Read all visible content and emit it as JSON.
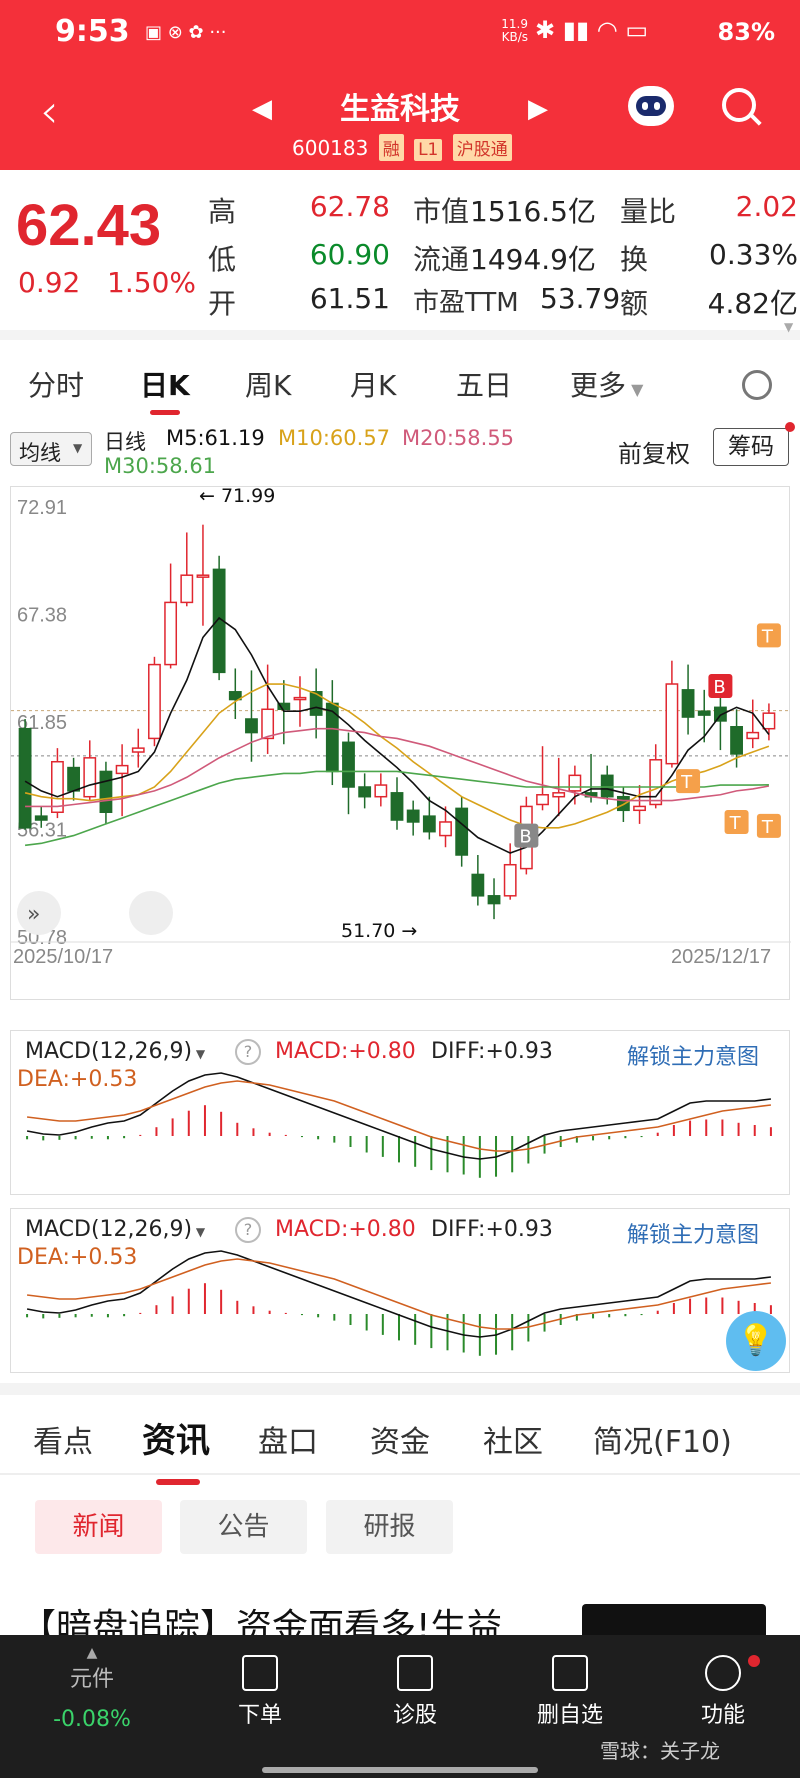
{
  "status": {
    "time": "9:53",
    "net": "11.9 KB/s",
    "battery": "83%"
  },
  "nav": {
    "title": "生益科技",
    "code": "600183",
    "tags": [
      "融",
      "L1",
      "沪股通"
    ]
  },
  "quote": {
    "price": "62.43",
    "change": "0.92",
    "change_pct": "1.50%",
    "rows": [
      {
        "l1": "高",
        "v1": "62.78",
        "l2": "市值",
        "v2": "1516.5亿",
        "l3": "量比",
        "v3": "2.02"
      },
      {
        "l1": "低",
        "v1": "60.90",
        "l2": "流通",
        "v2": "1494.9亿",
        "l3": "换",
        "v3": "0.33%"
      },
      {
        "l1": "开",
        "v1": "61.51",
        "l2": "市盈TTM",
        "v2": "53.79",
        "l3": "额",
        "v3": "4.82亿"
      }
    ]
  },
  "ktabs": [
    "分时",
    "日K",
    "周K",
    "月K",
    "五日",
    "更多"
  ],
  "ma": {
    "selector": "均线",
    "period": "日线",
    "m5": "M5:61.19",
    "m10": "M10:60.57",
    "m20": "M20:58.55",
    "m30": "M30:58.61",
    "adjust": "前复权",
    "chip_btn": "筹码"
  },
  "chart_data": {
    "type": "candlestick",
    "x_start": "2025/10/17",
    "x_end": "2025/12/17",
    "y_ticks": [
      "72.91",
      "67.38",
      "61.85",
      "56.31",
      "50.78"
    ],
    "ylim": [
      50.78,
      72.91
    ],
    "high_marker": "71.99",
    "low_marker": "51.70",
    "candles": [
      [
        61.5,
        56.4,
        62.0,
        56.3
      ],
      [
        57.0,
        56.8,
        57.5,
        56.4
      ],
      [
        57.2,
        59.8,
        60.5,
        56.9
      ],
      [
        59.5,
        58.3,
        60.0,
        57.8
      ],
      [
        58.0,
        60.0,
        60.9,
        57.8
      ],
      [
        59.3,
        57.2,
        59.8,
        56.6
      ],
      [
        59.2,
        59.6,
        60.7,
        57.0
      ],
      [
        60.3,
        60.5,
        61.5,
        59.5
      ],
      [
        61.0,
        64.8,
        65.2,
        60.6
      ],
      [
        64.8,
        68.0,
        70.0,
        64.6
      ],
      [
        68.0,
        69.4,
        71.6,
        67.8
      ],
      [
        69.3,
        69.4,
        72.0,
        66.8
      ],
      [
        69.7,
        64.4,
        70.4,
        64.0
      ],
      [
        63.4,
        63.0,
        64.6,
        62.0
      ],
      [
        62.0,
        61.3,
        64.5,
        59.8
      ],
      [
        61.0,
        62.5,
        64.8,
        60.2
      ],
      [
        62.8,
        62.5,
        64.0,
        60.7
      ],
      [
        63.0,
        63.1,
        64.2,
        61.6
      ],
      [
        63.4,
        62.2,
        64.6,
        61.0
      ],
      [
        62.8,
        59.3,
        64.0,
        58.6
      ],
      [
        60.8,
        58.5,
        61.3,
        57.1
      ],
      [
        58.5,
        58.0,
        59.2,
        57.4
      ],
      [
        58.0,
        58.6,
        59.2,
        57.5
      ],
      [
        58.2,
        56.8,
        59.0,
        56.3
      ],
      [
        57.3,
        56.7,
        57.8,
        56.0
      ],
      [
        57.0,
        56.2,
        58.0,
        55.8
      ],
      [
        56.0,
        56.7,
        57.5,
        55.4
      ],
      [
        57.4,
        55.0,
        58.0,
        54.4
      ],
      [
        54.0,
        52.9,
        55.0,
        52.4
      ],
      [
        52.9,
        52.5,
        53.8,
        51.7
      ],
      [
        52.9,
        54.5,
        55.6,
        52.7
      ],
      [
        54.3,
        57.5,
        58.0,
        54.0
      ],
      [
        57.6,
        58.1,
        60.6,
        57.3
      ],
      [
        58.0,
        58.2,
        60.0,
        57.0
      ],
      [
        58.3,
        59.1,
        59.6,
        57.6
      ],
      [
        58.2,
        58.0,
        60.2,
        57.7
      ],
      [
        59.1,
        58.0,
        59.6,
        57.6
      ],
      [
        58.0,
        57.3,
        58.5,
        56.7
      ],
      [
        57.3,
        57.5,
        58.6,
        56.6
      ],
      [
        57.6,
        59.9,
        60.7,
        57.4
      ],
      [
        59.7,
        63.8,
        65.0,
        59.5
      ],
      [
        63.5,
        62.1,
        64.8,
        61.2
      ],
      [
        62.4,
        62.2,
        63.5,
        60.8
      ],
      [
        62.6,
        61.9,
        63.3,
        60.4
      ],
      [
        61.6,
        60.2,
        62.5,
        59.5
      ],
      [
        61.0,
        61.3,
        63.0,
        60.5
      ],
      [
        61.5,
        62.3,
        62.8,
        60.9
      ]
    ],
    "ma_lines": [
      {
        "name": "M5",
        "color": "#111111",
        "values": [
          58.8,
          58.3,
          58.0,
          58.3,
          58.6,
          58.8,
          59.0,
          59.3,
          60.3,
          62.3,
          64.0,
          66.2,
          67.2,
          66.6,
          65.3,
          63.7,
          62.4,
          62.4,
          62.6,
          62.4,
          61.7,
          60.9,
          60.2,
          59.5,
          58.7,
          57.8,
          57.3,
          56.6,
          55.9,
          55.5,
          55.1,
          55.4,
          56.2,
          57.1,
          58.0,
          58.4,
          58.4,
          58.2,
          58.0,
          58.0,
          59.1,
          60.4,
          61.1,
          62.2,
          62.6,
          62.3,
          61.2
        ]
      },
      {
        "name": "M10",
        "color": "#d8a21a",
        "values": [
          58.2,
          58.0,
          57.9,
          57.9,
          57.8,
          57.9,
          58.0,
          58.1,
          58.5,
          59.3,
          60.3,
          61.3,
          62.3,
          62.9,
          63.4,
          63.8,
          63.8,
          63.6,
          63.3,
          62.8,
          62.4,
          61.8,
          61.1,
          60.5,
          59.8,
          59.2,
          58.6,
          58.0,
          57.6,
          57.2,
          56.8,
          56.5,
          56.4,
          56.4,
          56.6,
          56.9,
          57.2,
          57.6,
          58.1,
          58.4,
          58.8,
          59.1,
          59.3,
          59.6,
          60.0,
          60.3,
          60.6
        ]
      },
      {
        "name": "M20",
        "color": "#d05a7a",
        "values": [
          57.5,
          57.5,
          57.5,
          57.6,
          57.7,
          57.8,
          57.9,
          58.1,
          58.3,
          58.6,
          59.0,
          59.5,
          60.0,
          60.4,
          60.8,
          61.1,
          61.3,
          61.4,
          61.5,
          61.5,
          61.4,
          61.3,
          61.1,
          61.0,
          60.8,
          60.6,
          60.3,
          60.0,
          59.7,
          59.4,
          59.1,
          58.8,
          58.6,
          58.4,
          58.2,
          58.0,
          57.9,
          57.8,
          57.8,
          57.8,
          57.8,
          57.9,
          58.0,
          58.1,
          58.3,
          58.4,
          58.55
        ]
      },
      {
        "name": "M30",
        "color": "#4ca64c",
        "values": [
          55.5,
          55.6,
          55.8,
          56.0,
          56.3,
          56.6,
          56.9,
          57.2,
          57.5,
          57.8,
          58.1,
          58.4,
          58.7,
          58.9,
          59.0,
          59.1,
          59.2,
          59.2,
          59.3,
          59.3,
          59.3,
          59.3,
          59.3,
          59.3,
          59.2,
          59.1,
          59.0,
          58.9,
          58.8,
          58.7,
          58.6,
          58.5,
          58.5,
          58.5,
          58.5,
          58.5,
          58.5,
          58.5,
          58.5,
          58.5,
          58.5,
          58.5,
          58.5,
          58.6,
          58.6,
          58.6,
          58.61
        ]
      }
    ],
    "signals": [
      "B",
      "B",
      "T",
      "T",
      "T",
      "T"
    ]
  },
  "macd": [
    {
      "title": "MACD(12,26,9)",
      "macd": "MACD:+0.80",
      "diff": "DIFF:+0.93",
      "dea": "DEA:+0.53",
      "link": "解锁主力意图"
    },
    {
      "title": "MACD(12,26,9)",
      "macd": "MACD:+0.80",
      "diff": "DIFF:+0.93",
      "dea": "DEA:+0.53",
      "link": "解锁主力意图"
    }
  ],
  "newstabs": [
    "看点",
    "资讯",
    "盘口",
    "资金",
    "社区",
    "简况(F10)"
  ],
  "pills": [
    "新闻",
    "公告",
    "研报"
  ],
  "headline": "【暗盘追踪】资金面看多!生益",
  "footer": {
    "items": [
      {
        "label": "元件",
        "sub": "-0.08%"
      },
      {
        "label": "下单"
      },
      {
        "label": "诊股"
      },
      {
        "label": "删自选"
      },
      {
        "label": "功能"
      }
    ],
    "watermark": "雪球：关子龙"
  }
}
